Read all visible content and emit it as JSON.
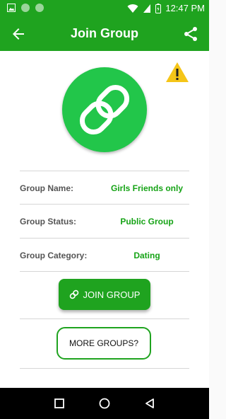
{
  "status_bar": {
    "time": "12:47 PM",
    "icons": [
      "image-icon",
      "notification-dot-icon",
      "notification-dot-icon",
      "wifi-icon",
      "signal-icon",
      "battery-icon"
    ]
  },
  "app_bar": {
    "title": "Join Group",
    "back_icon": "arrow-left-icon",
    "share_icon": "share-icon"
  },
  "warning_icon": "warning-icon",
  "group_logo_icon": "link-icon",
  "details": [
    {
      "label": "Group Name:",
      "value": "Girls Friends only"
    },
    {
      "label": "Group Status:",
      "value": "Public Group"
    },
    {
      "label": "Group Category:",
      "value": "Dating"
    }
  ],
  "join_button": {
    "label": "JOIN GROUP",
    "icon": "link-icon"
  },
  "more_button": {
    "label": "MORE GROUPS?"
  },
  "nav_bar": {
    "icons": [
      "recents-square-icon",
      "home-circle-icon",
      "back-triangle-icon"
    ]
  },
  "colors": {
    "primary": "#1fa31f",
    "logo": "#22c64a",
    "warning": "#f5c518",
    "value_text": "#16a316"
  }
}
